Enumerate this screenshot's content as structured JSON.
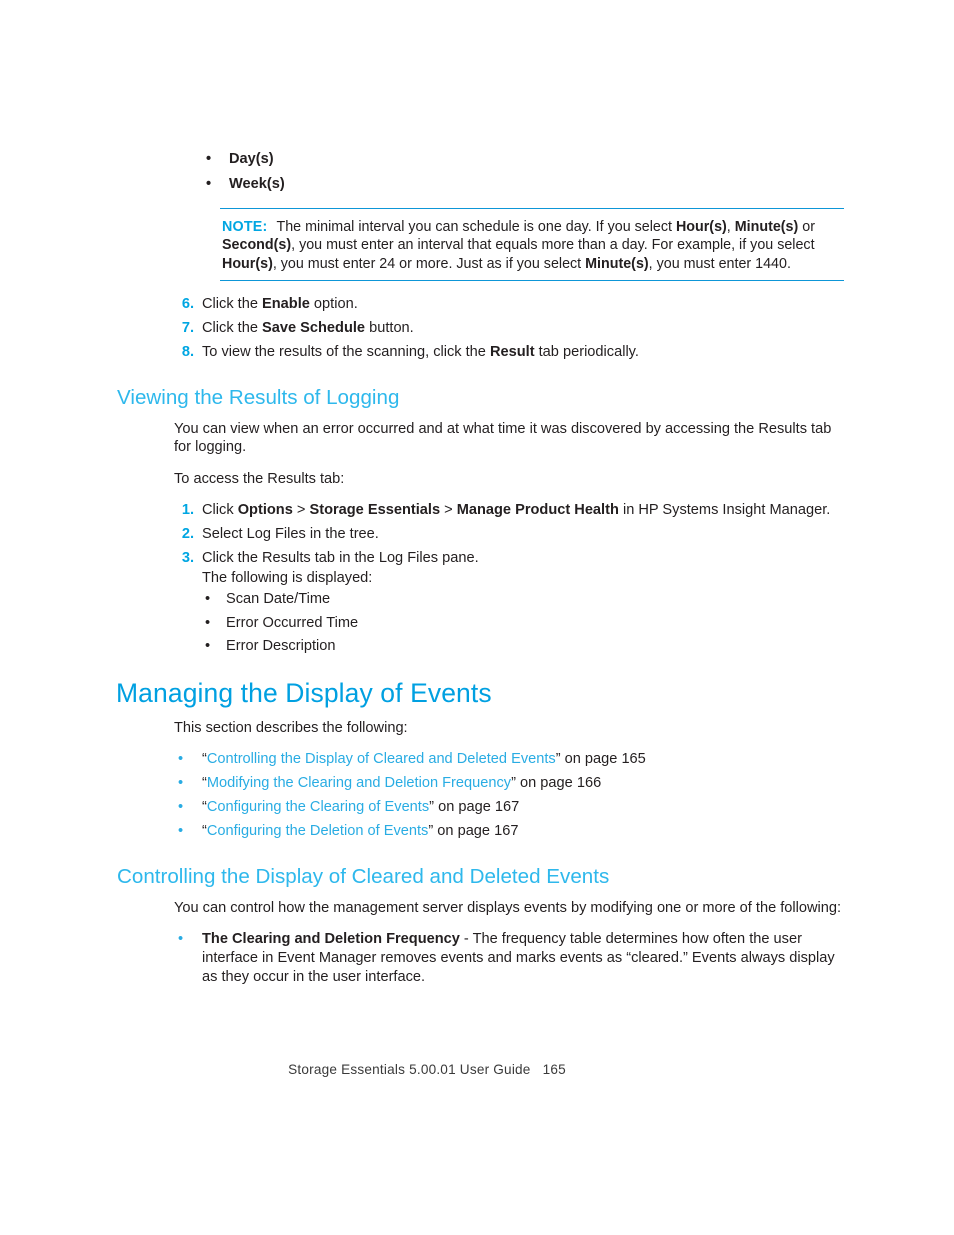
{
  "top_bullets": [
    {
      "text": "Day(s)"
    },
    {
      "text": "Week(s)"
    }
  ],
  "note": {
    "label": "NOTE:",
    "part1": "The minimal interval you can schedule is one day. If you select ",
    "bold1": "Hour(s)",
    "sep1": ", ",
    "bold2": "Minute(s)",
    "part2": " or ",
    "bold3": "Second(s)",
    "part3": ", you must enter an interval that equals more than a day. For example, if you select ",
    "bold4": "Hour(s)",
    "part4": ", you must enter 24 or more. Just as if you select ",
    "bold5": "Minute(s)",
    "part5": ", you must enter 1440."
  },
  "steps_continued": [
    {
      "num": "6.",
      "pre": "Click the ",
      "bold": "Enable",
      "post": " option."
    },
    {
      "num": "7.",
      "pre": "Click the ",
      "bold": "Save Schedule",
      "post": " button."
    },
    {
      "num": "8.",
      "pre": "To view the results of the scanning, click the ",
      "bold": "Result",
      "post": " tab periodically."
    }
  ],
  "section_logging": {
    "heading": "Viewing the Results of Logging",
    "intro": "You can view when an error occurred and at what time it was discovered by accessing the Results tab for logging.",
    "lead": "To access the Results tab:",
    "steps": [
      {
        "num": "1.",
        "pre": "Click ",
        "bold1": "Options",
        "gt1": " > ",
        "bold2": "Storage Essentials",
        "gt2": " > ",
        "bold3": "Manage Product Health",
        "post": " in HP Systems Insight Manager."
      },
      {
        "num": "2.",
        "pre": "Select Log Files in the tree.",
        "bold1": "",
        "gt1": "",
        "bold2": "",
        "gt2": "",
        "bold3": "",
        "post": ""
      },
      {
        "num": "3.",
        "pre": "Click the Results tab in the Log Files pane.",
        "bold1": "",
        "gt1": "",
        "bold2": "",
        "gt2": "",
        "bold3": "",
        "post": ""
      }
    ],
    "displayed_lead": "The following is displayed:",
    "displayed_items": [
      "Scan Date/Time",
      "Error Occurred Time",
      "Error Description"
    ]
  },
  "section_managing": {
    "heading": "Managing the Display of Events",
    "intro": "This section describes the following:",
    "links": [
      {
        "quote_open": "“",
        "title": "Controlling the Display of Cleared and Deleted Events",
        "quote_close": "”",
        "suffix": " on page 165"
      },
      {
        "quote_open": "“",
        "title": "Modifying the Clearing and Deletion Frequency",
        "quote_close": "”",
        "suffix": " on page 166"
      },
      {
        "quote_open": "“",
        "title": "Configuring the Clearing of Events",
        "quote_close": "”",
        "suffix": " on page 167"
      },
      {
        "quote_open": "“",
        "title": "Configuring the Deletion of Events",
        "quote_close": "”",
        "suffix": " on page 167"
      }
    ]
  },
  "section_controlling": {
    "heading": "Controlling the Display of Cleared and Deleted Events",
    "intro": "You can control how the management server displays events by modifying one or more of the following:",
    "bullet": {
      "bold": "The Clearing and Deletion Frequency",
      "rest": " - The frequency table determines how often the user interface in Event Manager removes events and marks events as “cleared.” Events always display as they occur in the user interface."
    }
  },
  "footer": {
    "guide": "Storage Essentials 5.00.01 User Guide",
    "page": "165"
  },
  "colors": {
    "accent_heading_major": "#00a0e1",
    "accent_heading_minor": "#2eb8ec",
    "accent_note": "#00a6e2",
    "accent_link": "#29ace3",
    "rule": "#0d96d7",
    "body_text": "#231f20"
  }
}
